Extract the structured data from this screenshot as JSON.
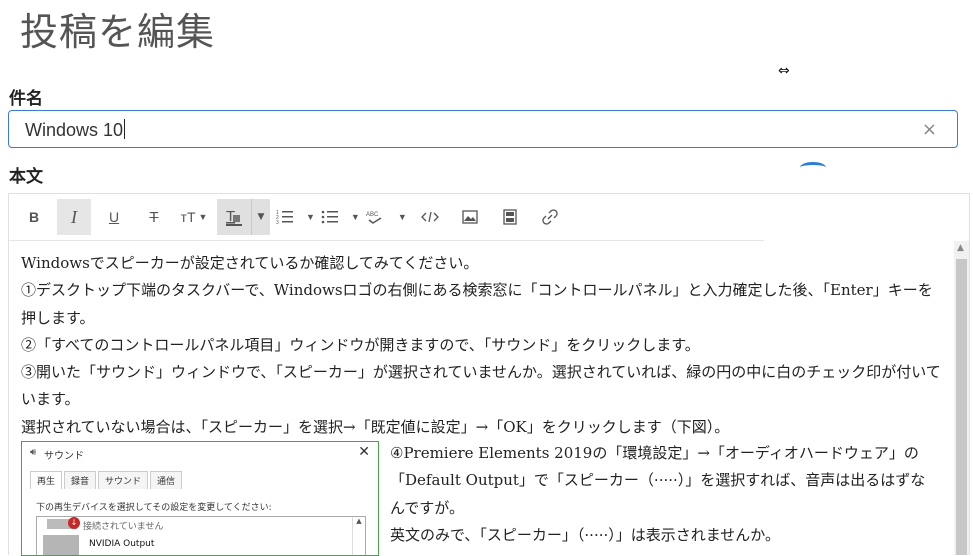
{
  "page": {
    "title": "投稿を編集"
  },
  "form": {
    "subject_label": "件名",
    "subject_value": "Windows 10",
    "clear_glyph": "×",
    "body_label": "本文"
  },
  "toolbar": {
    "bold": "B",
    "italic": "I",
    "underline": "U",
    "strikethrough": "T",
    "font_size": "тT",
    "items": [
      "bold-icon",
      "italic-icon",
      "underline-icon",
      "strikethrough-icon",
      "font-size-icon",
      "text-color-icon",
      "ordered-list-icon",
      "bullet-list-icon",
      "spellcheck-icon",
      "code-icon",
      "image-icon",
      "video-icon",
      "link-icon"
    ]
  },
  "body": {
    "paragraphs": [
      "Windowsでスピーカーが設定されているか確認してみてください。",
      "①デスクトップ下端のタスクバーで、Windowsロゴの右側にある検索窓に「コントロールパネル」と入力確定した後、「Enter」キーを押します。",
      "②「すべてのコントロールパネル項目」ウィンドウが開きますので、「サウンド」をクリックします。",
      "③開いた「サウンド」ウィンドウで、「スピーカー」が選択されていませんか。選択されていれば、緑の円の中に白のチェック印が付いています。",
      "選択されていない場合は、「スピーカー」を選択→「既定値に設定」→「OK」をクリックします（下図）。"
    ],
    "side_paragraphs": [
      "④Premiere Elements 2019の「環境設定」→「オーディオハードウェア」の「Default Output」で「スピーカー（·····）」を選択すれば、音声は出るはずなんですが。",
      "英文のみで、「スピーカー」（·····）」は表示されませんか。"
    ]
  },
  "dialog": {
    "title": "サウンド",
    "close": "✕",
    "tabs": [
      "再生",
      "録音",
      "サウンド",
      "通信"
    ],
    "description": "下の再生デバイスを選択してその設定を変更してください:",
    "device1": "接続されていません",
    "device2": "NVIDIA Output"
  },
  "colors": {
    "accent": "#3a7bd5",
    "dialog_border": "#4aa34a"
  }
}
